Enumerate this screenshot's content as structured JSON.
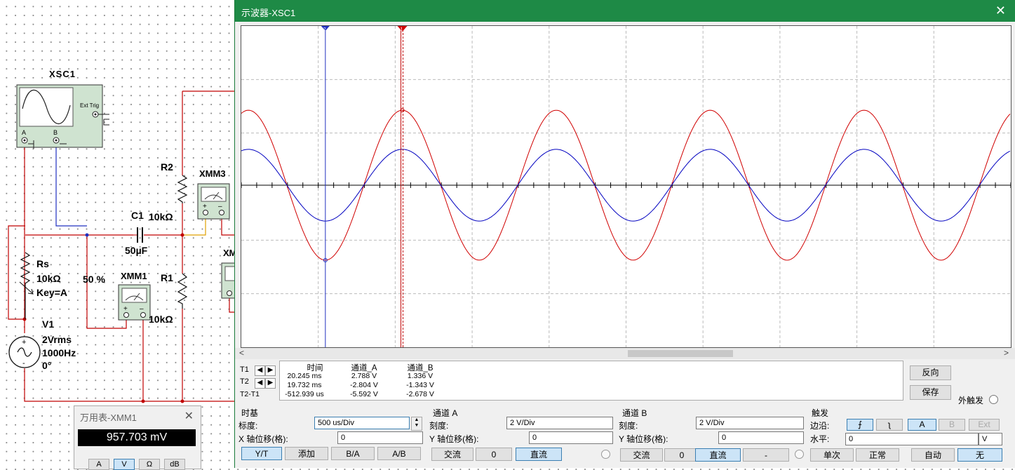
{
  "schematic": {
    "xsc1_label": "XSC1",
    "ext_trig": "Ext Trig",
    "ch_a": "A",
    "ch_b": "B",
    "r2_name": "R2",
    "r2_value": "10kΩ",
    "c1_name": "C1",
    "c1_value": "50µF",
    "xmm3": "XMM3",
    "xmm_partial": "XM",
    "rs_name": "Rs",
    "rs_value": "10kΩ",
    "rs_key": "Key=A",
    "rs_percent": "50 %",
    "xmm1": "XMM1",
    "r1_name": "R1",
    "r1_value": "10kΩ",
    "v1_name": "V1",
    "v1_amp": "2Vrms",
    "v1_freq": "1000Hz",
    "v1_phase": "0°"
  },
  "osc": {
    "title": "示波器-XSC1",
    "close": "✕",
    "cursor1": "1",
    "cursor2": "2",
    "colors": {
      "ch_a": "#d00000",
      "ch_b": "#0000c0",
      "bg": "#ffffff"
    },
    "readout": {
      "headers": [
        "时间",
        "通道_A",
        "通道_B"
      ],
      "rows": [
        {
          "label": "T1",
          "time": "20.245 ms",
          "a": "2.788 V",
          "b": "1.336 V"
        },
        {
          "label": "T2",
          "time": "19.732 ms",
          "a": "-2.804 V",
          "b": "-1.343 V"
        },
        {
          "label": "T2-T1",
          "time": "-512.939 us",
          "a": "-5.592 V",
          "b": "-2.678 V"
        }
      ]
    },
    "reverse_btn": "反向",
    "save_btn": "保存",
    "ext_trigger": "外触发",
    "timebase": {
      "title": "时基",
      "scale_label": "标度:",
      "scale_value": "500 us/Div",
      "xpos_label": "X 轴位移(格):",
      "xpos_value": "0",
      "btn_yt": "Y/T",
      "btn_add": "添加",
      "btn_ba": "B/A",
      "btn_ab": "A/B"
    },
    "channel_a": {
      "title": "通道 A",
      "scale_label": "刻度:",
      "scale_value": "2  V/Div",
      "ypos_label": "Y 轴位移(格):",
      "ypos_value": "0",
      "btn_ac": "交流",
      "btn_zero": "0",
      "btn_dc": "直流"
    },
    "channel_b": {
      "title": "通道 B",
      "scale_label": "刻度:",
      "scale_value": "2  V/Div",
      "ypos_label": "Y 轴位移(格):",
      "ypos_value": "0",
      "btn_ac": "交流",
      "btn_zero": "0",
      "btn_dc": "直流",
      "btn_minus": "-"
    },
    "trigger": {
      "title": "触发",
      "edge_label": "边沿:",
      "btn_a": "A",
      "btn_b": "B",
      "btn_ext": "Ext",
      "level_label": "水平:",
      "level_value": "0",
      "level_unit": "V",
      "btn_single": "单次",
      "btn_normal": "正常",
      "btn_auto": "自动",
      "btn_none": "无"
    }
  },
  "multimeter": {
    "title": "万用表-XMM1",
    "close": "✕",
    "reading": "957.703 mV",
    "buttons": [
      "A",
      "V",
      "Ω",
      "dB"
    ]
  },
  "chart_data": {
    "type": "line",
    "xlabel": "",
    "ylabel": "",
    "time_per_div": "500 us/Div",
    "volts_per_div": "2 V/Div",
    "series": [
      {
        "name": "通道_A",
        "color": "#d00000",
        "amplitude_v": 2.8,
        "frequency_hz": 1000
      },
      {
        "name": "通道_B",
        "color": "#0000c0",
        "amplitude_v": 1.34,
        "frequency_hz": 1000
      }
    ],
    "cursors": [
      {
        "name": "T1",
        "time_ms": 20.245
      },
      {
        "name": "T2",
        "time_ms": 19.732
      }
    ]
  }
}
